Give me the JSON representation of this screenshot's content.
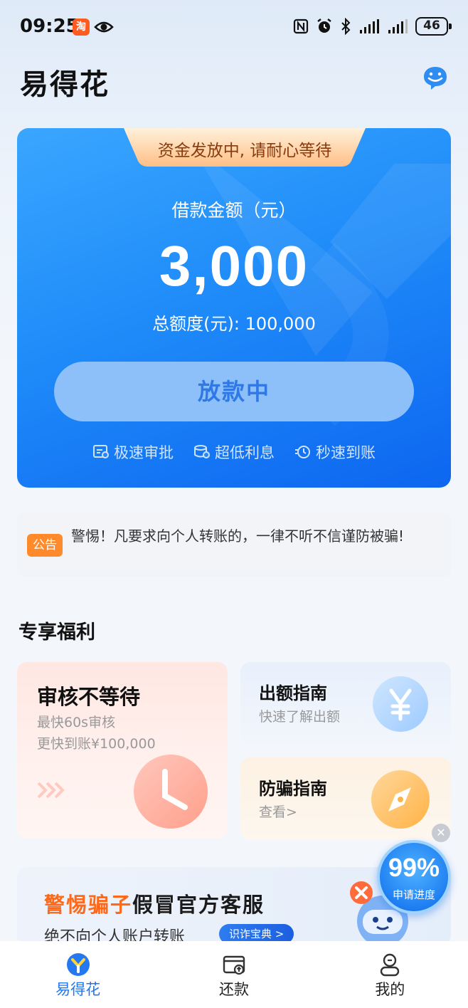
{
  "status_bar": {
    "time": "09:25",
    "app_badge": "淘",
    "battery": "46"
  },
  "header": {
    "title": "易得花"
  },
  "hero": {
    "ribbon": "资金发放中, 请耐心等待",
    "loan_label": "借款金额（元）",
    "loan_amount": "3,000",
    "total_credit": "总额度(元): 100,000",
    "status_button": "放款中",
    "features": [
      "极速审批",
      "超低利息",
      "秒速到账"
    ]
  },
  "notice": {
    "badge": "公告",
    "text": "警惕！凡要求向个人转账的，一律不听不信谨防被骗!"
  },
  "benefits": {
    "title": "专享福利",
    "main_card": {
      "title": "审核不等待",
      "line1": "最快60s审核",
      "line2": "更快到账¥100,000"
    },
    "guide_card": {
      "title": "出额指南",
      "sub": "快速了解出额"
    },
    "fraud_card": {
      "title": "防骗指南",
      "sub": "查看>"
    }
  },
  "banner": {
    "highlight": "警惕骗子",
    "rest": "假冒官方客服",
    "sub": "绝不向个人账户转账",
    "button": "识诈宝典 >"
  },
  "progress_float": {
    "value": "99%",
    "label": "申请进度",
    "progress_percent": 99
  },
  "tabbar": {
    "tabs": [
      {
        "label": "易得花",
        "active": true
      },
      {
        "label": "还款",
        "active": false
      },
      {
        "label": "我的",
        "active": false
      }
    ]
  },
  "colors": {
    "primary": "#1f78f0",
    "accent": "#ff8a2c",
    "hero_start": "#3aa6ff",
    "hero_end": "#0d66f0"
  },
  "icons": [
    "eye-icon",
    "nfc-icon",
    "alarm-icon",
    "bluetooth-icon",
    "signal-icon",
    "chat-icon",
    "approval-icon",
    "coins-icon",
    "clock-fast-icon",
    "clock-icon",
    "yen-icon",
    "compass-icon",
    "robot-icon",
    "close-icon",
    "home-logo-icon",
    "repay-icon",
    "profile-icon"
  ]
}
